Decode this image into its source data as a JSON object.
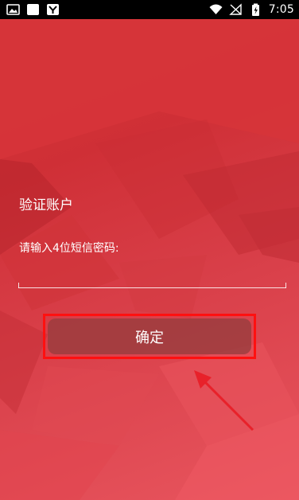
{
  "status_bar": {
    "time": "7:05",
    "icons": [
      "image-icon",
      "square-icon",
      "app-y-icon",
      "wifi-icon",
      "no-signal-icon",
      "battery-charging-icon"
    ]
  },
  "page": {
    "title": "验证账户",
    "prompt": "请输入4位短信密码:",
    "code_input": {
      "value": "",
      "placeholder": ""
    },
    "confirm_label": "确定"
  },
  "colors": {
    "background": "#d83a3e",
    "button": "#963c3e",
    "highlight": "#ff1010",
    "arrow": "#e8212a"
  }
}
